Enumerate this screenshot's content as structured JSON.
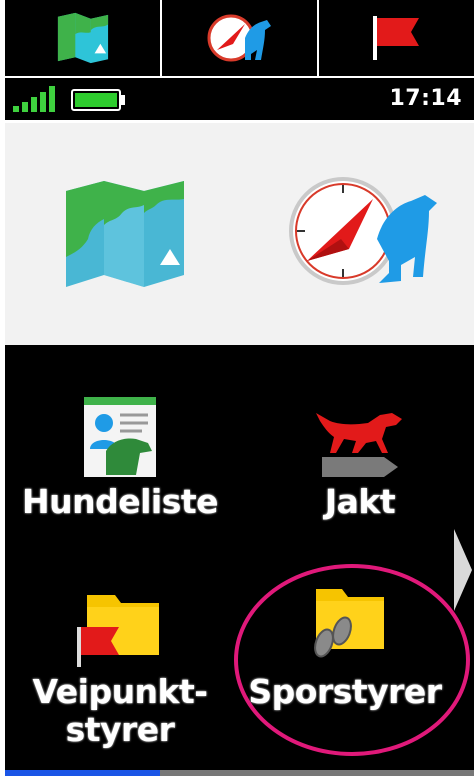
{
  "shortcuts": [
    {
      "icon": "map-icon"
    },
    {
      "icon": "dog-compass-icon"
    },
    {
      "icon": "waypoint-flag-icon"
    }
  ],
  "status": {
    "signal_bars": 5,
    "battery_level": 1.0,
    "time": "17:14"
  },
  "hero": {
    "items": [
      {
        "icon": "map-icon"
      },
      {
        "icon": "dog-compass-icon"
      }
    ]
  },
  "apps": [
    {
      "label": "Hundeliste",
      "icon": "dog-list-icon"
    },
    {
      "label": "Jakt",
      "icon": "hunting-dog-icon"
    },
    {
      "label_lines": [
        "Veipunkt-",
        "styrer"
      ],
      "icon": "waypoint-folder-icon"
    },
    {
      "label": "Sporstyrer",
      "icon": "track-folder-icon"
    }
  ],
  "page": {
    "progress": 0.33
  },
  "colors": {
    "background": "#000000",
    "highlight": "#e0197a",
    "accent": "#1a55e6",
    "battery": "#2ecc2e",
    "flag": "#e21a1a",
    "folder": "#f6c400",
    "dog_blue": "#1f9be6"
  }
}
